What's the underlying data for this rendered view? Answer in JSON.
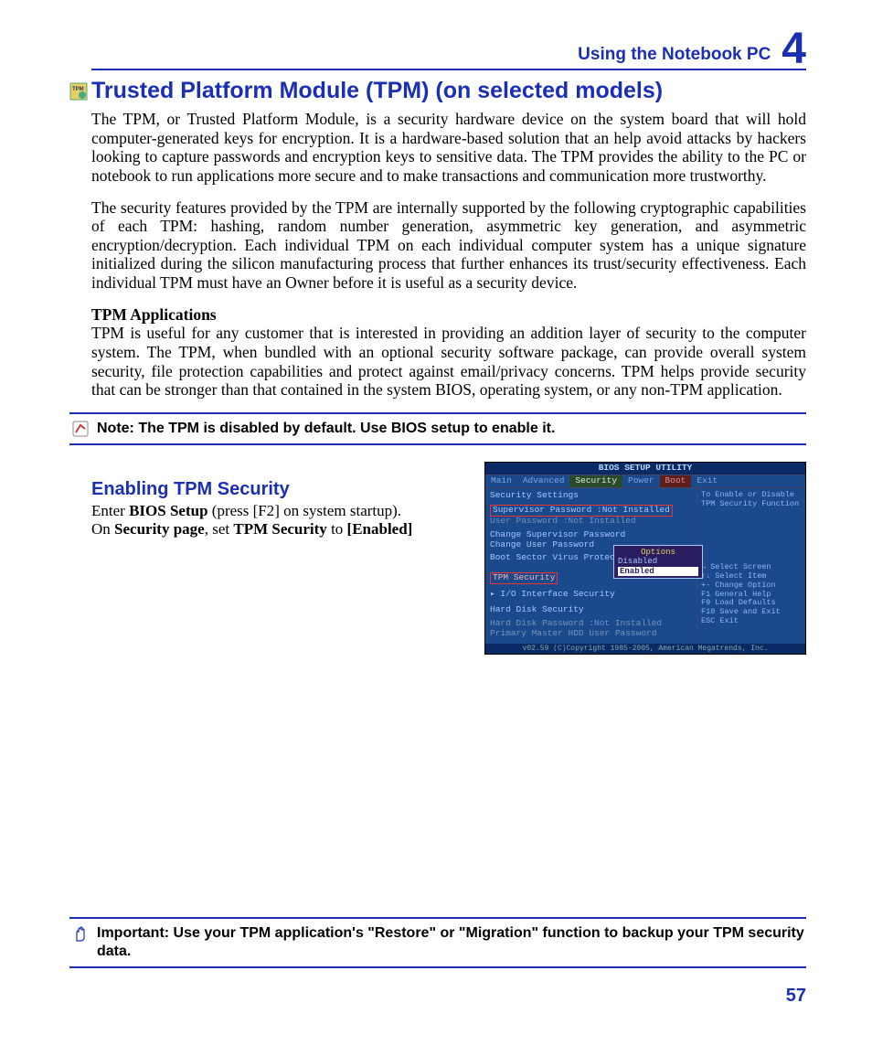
{
  "header": {
    "section": "Using the Notebook PC",
    "chapter": "4"
  },
  "title": "Trusted Platform Module (TPM) (on selected models)",
  "para1": "The TPM, or Trusted Platform Module, is a security hardware device on the system board that will hold computer-generated keys for encryption. It is a hardware-based solution that an help avoid attacks by hackers looking to capture passwords and encryption keys to sensitive data. The TPM provides the ability to the PC or notebook to run applications more secure and to make transactions and communication more trustworthy.",
  "para2": "The security features provided by the TPM are internally supported by the following cryptographic capabilities of each TPM: hashing, random number generation, asymmetric key generation, and asymmetric encryption/decryption. Each individual TPM on each individual computer system has a unique signature initialized during the silicon manufacturing process that further enhances its trust/security effectiveness. Each individual TPM must have an Owner before it is useful as a security device.",
  "sub1_heading": "TPM Applications",
  "sub1_body": "TPM is useful for any customer that is interested in providing an addition layer of security to the computer system. The TPM, when bundled with an optional security software package, can provide overall system security, file protection capabilities and protect against email/privacy concerns. TPM helps provide security that can be stronger than that contained in the system BIOS, operating system, or any non-TPM application.",
  "note": "Note: The TPM is disabled by default. Use BIOS setup to enable it.",
  "h2": "Enabling TPM Security",
  "steps": {
    "l1a": "Enter ",
    "l1b": "BIOS Setup",
    "l1c": " (press [F2] on system startup).",
    "l2a": "On ",
    "l2b": "Security page",
    "l2c": ", set ",
    "l2d": "TPM Security",
    "l2e": " to ",
    "l2f": "[Enabled]"
  },
  "bios": {
    "title": "BIOS SETUP UTILITY",
    "tabs": [
      "Main",
      "Advanced",
      "Security",
      "Power",
      "Boot",
      "Exit"
    ],
    "sec_heading": "Security Settings",
    "sup_pwd": "Supervisor Password  :Not Installed",
    "usr_pwd": "User Password        :Not Installed",
    "chg_sup": "Change Supervisor Password",
    "chg_usr": "Change User Password",
    "boot_sec": "Boot Sector Virus Protectio",
    "tpm_sec": "TPM Security",
    "io_sec": "▸ I/O Interface Security",
    "hd_sec": "Hard Disk Security",
    "hd_pwd": "Hard Disk Password  :Not Installed",
    "pm_pwd": "Primary Master HDD User Password",
    "help_title": "To Enable or Disable TPM Security Function",
    "popup": {
      "hdr": "Options",
      "opt1": "Disabled",
      "opt2": "Enabled"
    },
    "keys": {
      "a": "↔   Select Screen",
      "b": "↑↓  Select Item",
      "c": "+-  Change Option",
      "d": "F1  General Help",
      "e": "F9  Load Defaults",
      "f": "F10 Save and Exit",
      "g": "ESC Exit"
    },
    "footer": "v02.59 (C)Copyright 1985-2005, American Megatrends, Inc."
  },
  "important": "Important: Use your TPM application's \"Restore\" or \"Migration\" function to backup your TPM security data.",
  "pagenum": "57"
}
